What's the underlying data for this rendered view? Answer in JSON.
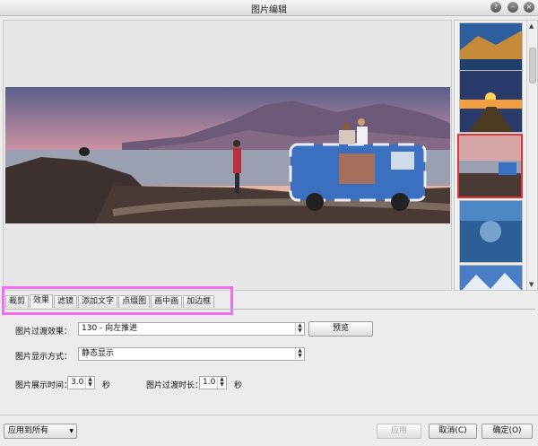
{
  "window": {
    "title": "图片编辑"
  },
  "preview": {
    "image": "landscape-photo-van-by-sea"
  },
  "thumbnails": [
    {
      "name": "mountain-lake-autumn"
    },
    {
      "name": "sunset-pier"
    },
    {
      "name": "coast-van-selected"
    },
    {
      "name": "blue-lake"
    },
    {
      "name": "snowy-mountains"
    }
  ],
  "tabs": [
    "裁剪",
    "效果",
    "滤镜",
    "添加文字",
    "点缀图",
    "画中画",
    "加边框"
  ],
  "effects": {
    "transition_label": "图片过渡效果：",
    "transition_value": "130 - 向左推进",
    "preview_button": "预览",
    "display_label": "图片显示方式：",
    "display_value": "静态显示",
    "show_time_label": "图片展示时间：",
    "show_time_value": "3.0",
    "show_time_unit": "秒",
    "trans_time_label": "图片过渡时长：",
    "trans_time_value": "1.0",
    "trans_time_unit": "秒"
  },
  "footer": {
    "apply_all": "应用到所有",
    "apply": "应用",
    "cancel": "取消(C)",
    "ok": "确定(O)"
  },
  "colors": {
    "highlight": "#f06cf0",
    "selected_thumb": "#e23434"
  }
}
